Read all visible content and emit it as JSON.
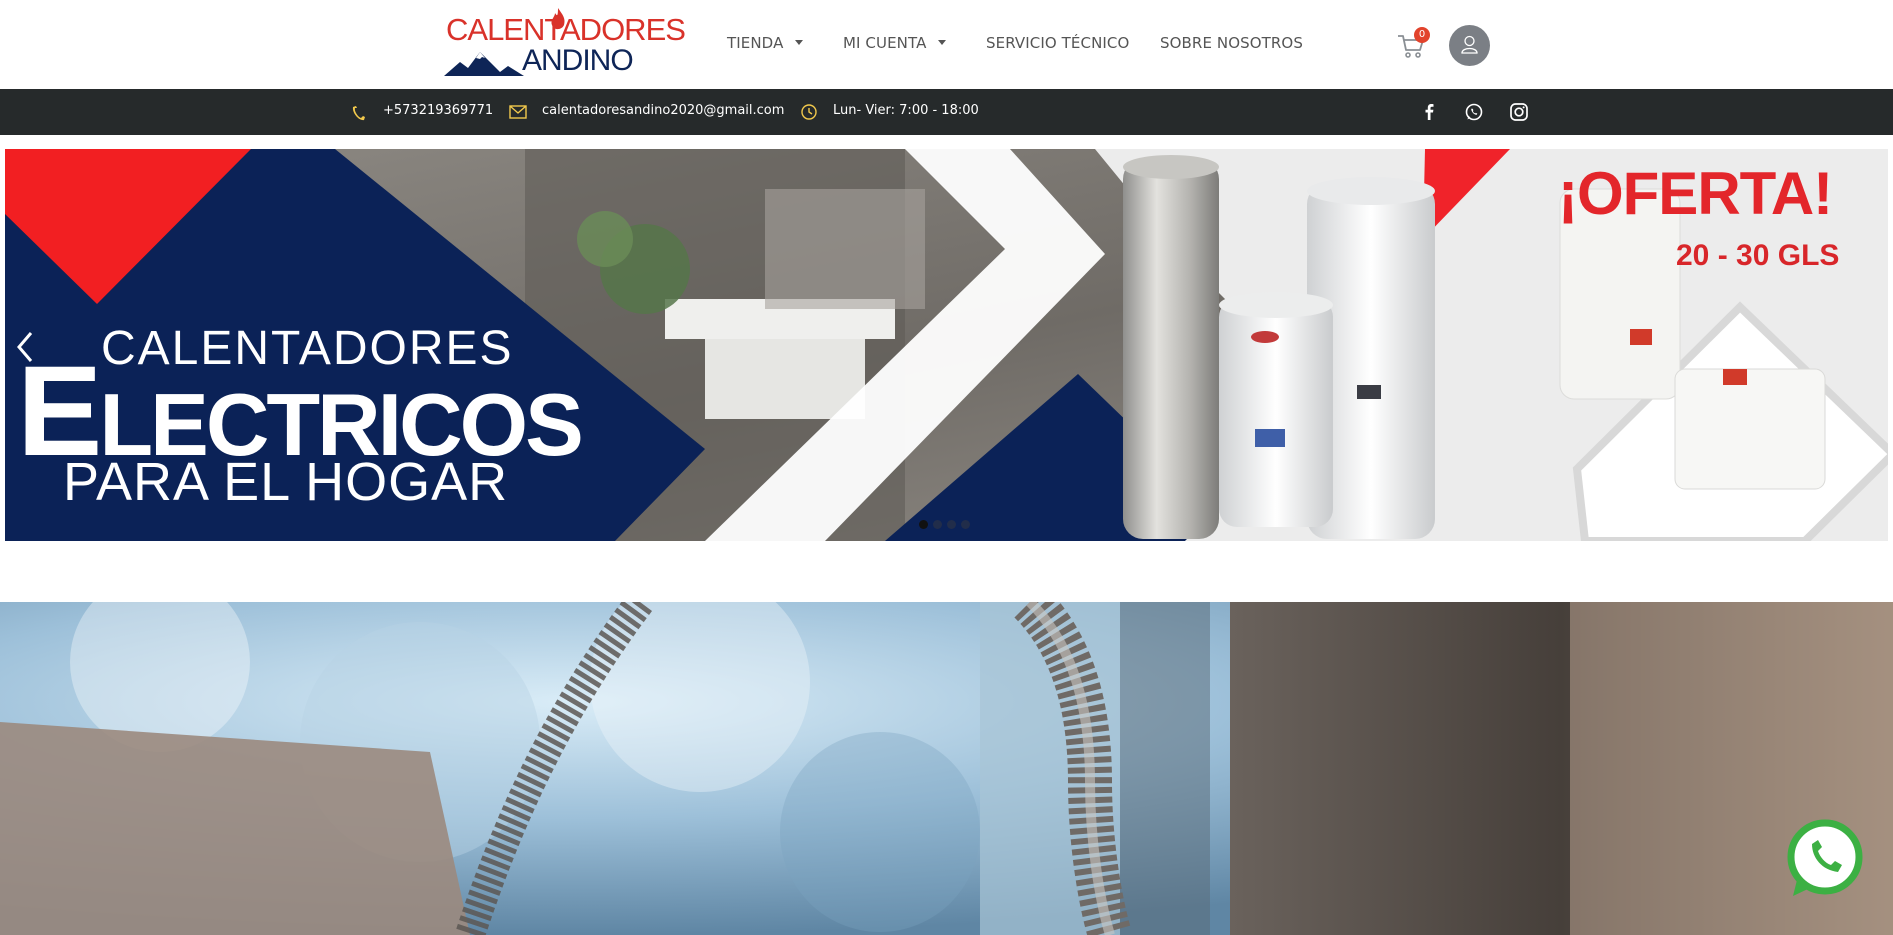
{
  "header": {
    "logo": {
      "line1": "CALENTADORES",
      "line2": "ANDINO"
    },
    "nav": [
      {
        "label": "TIENDA",
        "dropdown": true
      },
      {
        "label": "MI CUENTA",
        "dropdown": true
      },
      {
        "label": "SERVICIO TÉCNICO",
        "dropdown": false
      },
      {
        "label": "SOBRE NOSOTROS",
        "dropdown": false
      }
    ],
    "cart_count": "0",
    "icons": {
      "cart": "cart-icon",
      "account": "user-icon"
    }
  },
  "topbar": {
    "phone": "+573219369771",
    "email": "calentadoresandino2020@gmail.com",
    "hours": "Lun- Vier: 7:00 - 18:00",
    "social": [
      "facebook-icon",
      "whatsapp-icon",
      "instagram-icon"
    ]
  },
  "banner": {
    "line1": "CALENTADORES",
    "line2_initial": "E",
    "line2_rest": "LECTRICOS",
    "line3": "PARA EL HOGAR",
    "offer": "¡OFERTA!",
    "offer_sub": "20 - 30 GLS",
    "slide_count": 4,
    "active_slide": 0
  },
  "colors": {
    "navy": "#0b2257",
    "red": "#e3262b",
    "topbar": "#262a2b",
    "accent_yellow": "#f2c94c",
    "whatsapp": "#3cb043"
  }
}
